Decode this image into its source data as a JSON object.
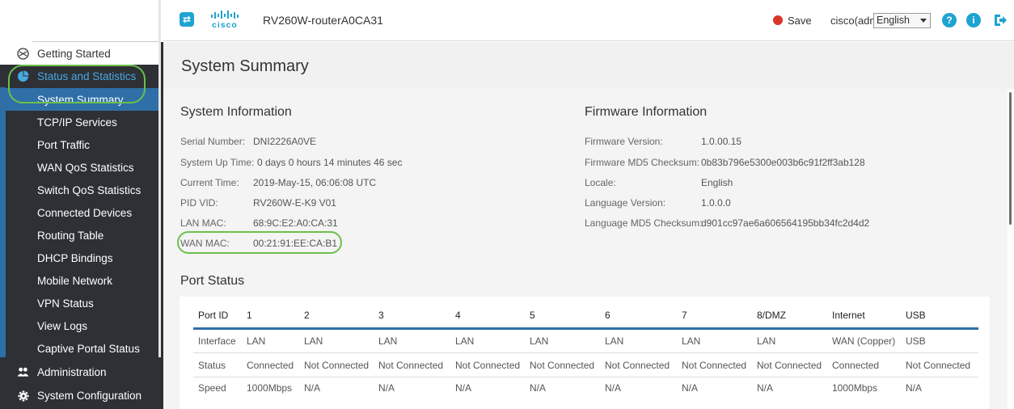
{
  "header": {
    "brand": "cisco",
    "device_name": "RV260W-routerA0CA31",
    "save_label": "Save",
    "user_label": "cisco(admin)",
    "language": "English"
  },
  "sidebar": {
    "items": [
      {
        "label": "Getting Started",
        "icon": "getting-started-icon"
      },
      {
        "label": "Status and Statistics",
        "icon": "pie-chart-icon"
      },
      {
        "label": "System Summary"
      },
      {
        "label": "TCP/IP Services"
      },
      {
        "label": "Port Traffic"
      },
      {
        "label": "WAN QoS Statistics"
      },
      {
        "label": "Switch QoS Statistics"
      },
      {
        "label": "Connected Devices"
      },
      {
        "label": "Routing Table"
      },
      {
        "label": "DHCP Bindings"
      },
      {
        "label": "Mobile Network"
      },
      {
        "label": "VPN Status"
      },
      {
        "label": "View Logs"
      },
      {
        "label": "Captive Portal Status"
      },
      {
        "label": "Administration",
        "icon": "users-icon"
      },
      {
        "label": "System Configuration",
        "icon": "gear-icon"
      }
    ]
  },
  "page": {
    "title": "System Summary"
  },
  "system_information": {
    "title": "System Information",
    "rows": [
      {
        "label": "Serial Number:",
        "value": "DNI2226A0VE"
      },
      {
        "label": "System Up Time:",
        "value": "0 days 0 hours 14 minutes 46 sec"
      },
      {
        "label": "Current Time:",
        "value": "2019-May-15, 06:06:08 UTC"
      },
      {
        "label": "PID VID:",
        "value": "RV260W-E-K9 V01"
      },
      {
        "label": "LAN MAC:",
        "value": "68:9C:E2:A0:CA:31"
      },
      {
        "label": "WAN MAC:",
        "value": "00:21:91:EE:CA:B1"
      }
    ]
  },
  "firmware_information": {
    "title": "Firmware Information",
    "rows": [
      {
        "label": "Firmware Version:",
        "value": "1.0.00.15"
      },
      {
        "label": "Firmware MD5 Checksum:",
        "value": "0b83b796e5300e003b6c91f2ff3ab128"
      },
      {
        "label": "Locale:",
        "value": "English"
      },
      {
        "label": "Language Version:",
        "value": "1.0.0.0"
      },
      {
        "label": "Language MD5 Checksum:",
        "value": "d901cc97ae6a606564195bb34fc2d4d2"
      }
    ]
  },
  "port_status": {
    "title": "Port Status",
    "columns": [
      "Port ID",
      "1",
      "2",
      "3",
      "4",
      "5",
      "6",
      "7",
      "8/DMZ",
      "Internet",
      "USB"
    ],
    "rows": [
      [
        "Interface",
        "LAN",
        "LAN",
        "LAN",
        "LAN",
        "LAN",
        "LAN",
        "LAN",
        "LAN",
        "WAN (Copper)",
        "USB"
      ],
      [
        "Status",
        "Connected",
        "Not Connected",
        "Not Connected",
        "Not Connected",
        "Not Connected",
        "Not Connected",
        "Not Connected",
        "Not Connected",
        "Connected",
        "Not Connected"
      ],
      [
        "Speed",
        "1000Mbps",
        "N/A",
        "N/A",
        "N/A",
        "N/A",
        "N/A",
        "N/A",
        "N/A",
        "1000Mbps",
        "N/A"
      ]
    ]
  },
  "colors": {
    "sidebar_bg": "#2d3035",
    "active_item_bg": "#2f6fa7",
    "active_section_text": "#4aa8e0",
    "accent": "#1fa3d1",
    "highlight_ring": "#6cc04a",
    "save_icon": "#d9362b"
  }
}
